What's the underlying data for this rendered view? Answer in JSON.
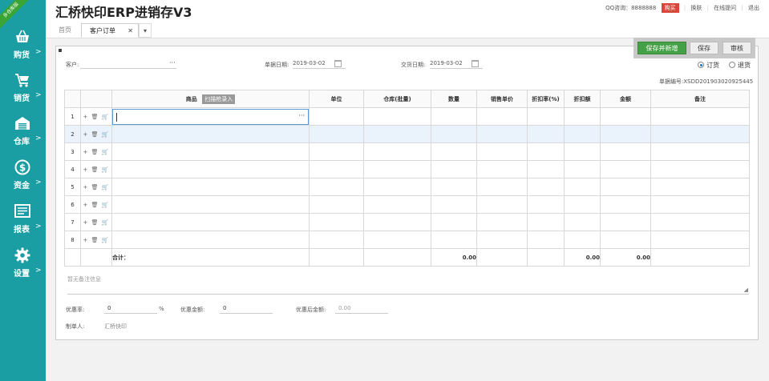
{
  "sidebar": {
    "ribbon": "多仓库版",
    "items": [
      {
        "label": "购货",
        "icon": "basket-icon"
      },
      {
        "label": "销货",
        "icon": "cart-icon"
      },
      {
        "label": "仓库",
        "icon": "warehouse-icon"
      },
      {
        "label": "资金",
        "icon": "dollar-icon"
      },
      {
        "label": "报表",
        "icon": "report-icon"
      },
      {
        "label": "设置",
        "icon": "gear-icon"
      }
    ],
    "arrow": ">"
  },
  "header": {
    "title": "汇桥快印ERP进销存V3",
    "qq": "QQ咨询：8888888",
    "buy": "购买",
    "skin": "换肤",
    "help": "在线提问",
    "logout": "退出",
    "sep": "|"
  },
  "tabs": {
    "home": "首页",
    "active": "客户订单",
    "close": "✕",
    "dropdown": "▾"
  },
  "actions": {
    "save_new": "保存并新增",
    "save": "保存",
    "audit": "审核"
  },
  "form": {
    "customer_label": "客户:",
    "customer_value": "",
    "dots": "···",
    "bill_date_label": "单据日期:",
    "bill_date": "2019-03-02",
    "delivery_date_label": "交货日期:",
    "delivery_date": "2019-03-02",
    "order_option": "订货",
    "return_option": "退货",
    "bill_no": "单据编号:XSDD201903020925445"
  },
  "grid": {
    "headers": {
      "product": "商品",
      "scan": "扫描枪录入",
      "unit": "单位",
      "warehouse": "仓库(批量)",
      "qty": "数量",
      "price": "销售单价",
      "discount_rate": "折扣率(%)",
      "discount_amt": "折扣额",
      "amount": "金额",
      "remark": "备注"
    },
    "rows": [
      "1",
      "2",
      "3",
      "4",
      "5",
      "6",
      "7",
      "8"
    ],
    "ops": "+ 🗑 🛒",
    "total_label": "合计：",
    "total_qty": "0.00",
    "total_discount": "0.00",
    "total_amount": "0.00"
  },
  "footer": {
    "remark_placeholder": "暂无备注信息",
    "discount_rate_label": "优惠率:",
    "discount_rate_value": "0",
    "percent": "%",
    "discount_amt_label": "优惠金额:",
    "discount_amt_value": "0",
    "after_discount_label": "优惠后金额:",
    "after_discount_value": "0.00",
    "maker_label": "制单人:",
    "maker_value": "汇桥快印"
  }
}
